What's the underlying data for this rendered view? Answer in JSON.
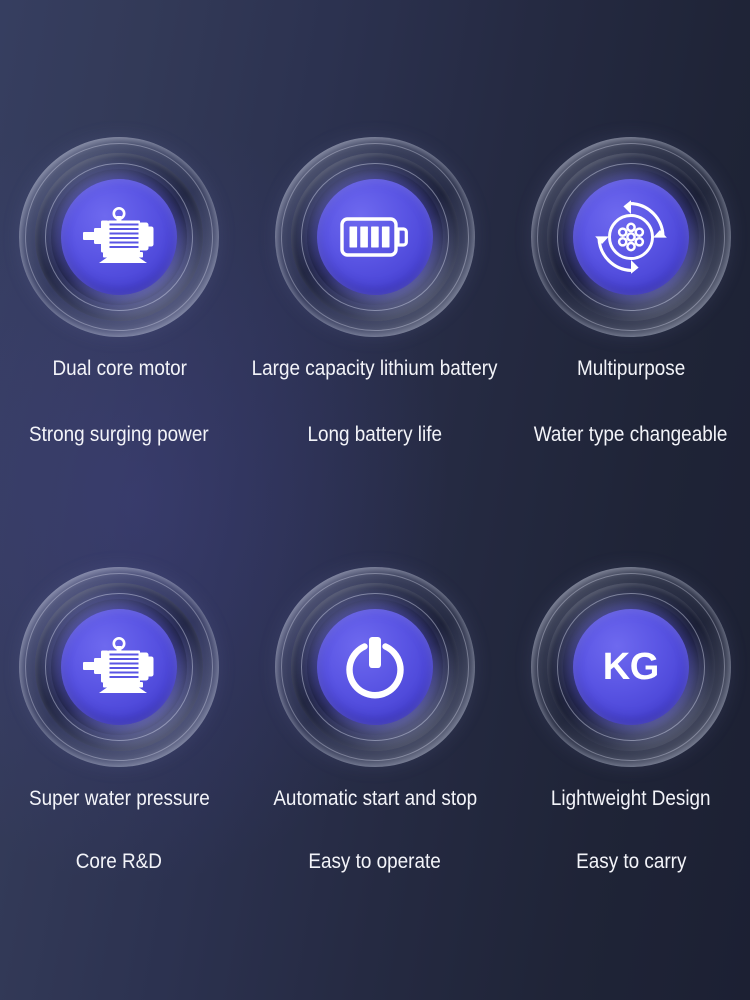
{
  "theme": {
    "background_left": "#363e60",
    "background_right": "#1c2033",
    "disc_color": "#5a55e4",
    "text_color": "#f3f4f9"
  },
  "features": [
    {
      "icon": "electric-motor-icon",
      "title": "Dual core motor",
      "subtitle": "Strong surging power"
    },
    {
      "icon": "battery-full-icon",
      "title": "Large capacity lithium battery",
      "subtitle": "Long battery life"
    },
    {
      "icon": "rotating-nozzle-icon",
      "title": "Multipurpose",
      "subtitle": "Water type changeable"
    },
    {
      "icon": "electric-motor-icon",
      "title": "Super water pressure",
      "subtitle": "Core R&D"
    },
    {
      "icon": "power-button-icon",
      "title": "Automatic start and stop",
      "subtitle": "Easy to operate"
    },
    {
      "icon": "kg-weight-icon",
      "title": "Lightweight Design",
      "subtitle": "Easy to carry",
      "icon_text": "KG"
    }
  ]
}
